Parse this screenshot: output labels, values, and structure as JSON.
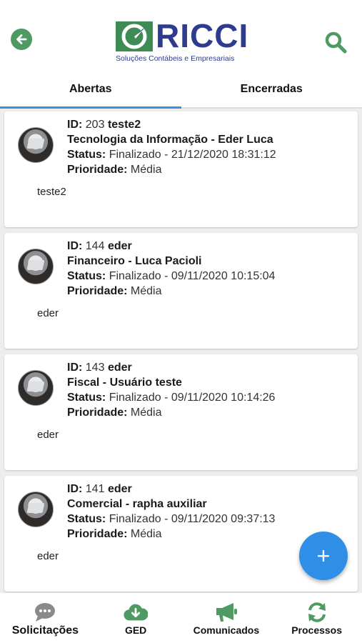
{
  "brand": {
    "name": "RICCI",
    "tagline": "Soluções Contábeis e Empresariais"
  },
  "tabs": [
    {
      "label": "Abertas",
      "active": true
    },
    {
      "label": "Encerradas",
      "active": false
    }
  ],
  "labels": {
    "id": "ID:",
    "status": "Status:",
    "priority": "Prioridade:"
  },
  "tickets": [
    {
      "id": "203",
      "user": "teste2",
      "title": "Tecnologia da Informação - Eder Luca",
      "status": "Finalizado - 21/12/2020 18:31:12",
      "priority": "Média",
      "message": "teste2"
    },
    {
      "id": "144",
      "user": "eder",
      "title": "Financeiro - Luca Pacioli",
      "status": "Finalizado - 09/11/2020 10:15:04",
      "priority": "Média",
      "message": "eder"
    },
    {
      "id": "143",
      "user": "eder",
      "title": "Fiscal - Usuário teste",
      "status": "Finalizado - 09/11/2020 10:14:26",
      "priority": "Média",
      "message": "eder"
    },
    {
      "id": "141",
      "user": "eder",
      "title": "Comercial - rapha auxiliar",
      "status": "Finalizado - 09/11/2020 09:37:13",
      "priority": "Média",
      "message": "eder"
    }
  ],
  "fab": {
    "label": "+"
  },
  "nav": [
    {
      "label": "Solicitações",
      "icon": "chat-icon",
      "active": true
    },
    {
      "label": "GED",
      "icon": "cloud-download-icon",
      "active": false
    },
    {
      "label": "Comunicados",
      "icon": "megaphone-icon",
      "active": false
    },
    {
      "label": "Processos",
      "icon": "refresh-icon",
      "active": false
    }
  ],
  "colors": {
    "accent": "#4f9a63",
    "tab_indicator": "#3d8ed8",
    "fab": "#2f8fe6",
    "brand_blue": "#2f3b8f",
    "inactive_icon": "#8a8a8a"
  }
}
